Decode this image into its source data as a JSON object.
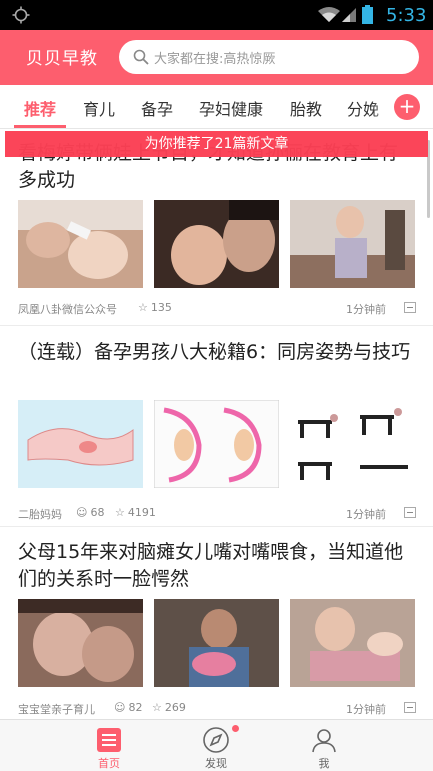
{
  "status_bar": {
    "time": "5:33",
    "icons": [
      "gps-icon",
      "wifi-icon",
      "signal-icon",
      "battery-icon"
    ]
  },
  "header": {
    "app_title": "贝贝早教",
    "search_placeholder": "大家都在搜:高热惊厥",
    "accent_color": "#fd5e6e"
  },
  "tabs": [
    {
      "label": "推荐",
      "active": true
    },
    {
      "label": "育儿",
      "active": false
    },
    {
      "label": "备孕",
      "active": false
    },
    {
      "label": "孕妇健康",
      "active": false
    },
    {
      "label": "胎教",
      "active": false
    },
    {
      "label": "分娩",
      "active": false
    }
  ],
  "add_tab_label": "+",
  "toast": "为你推荐了21篇新文章",
  "articles": [
    {
      "title": "看梅婷带俩娃上节目，才知道孙俪在教育上有多成功",
      "source": "凤凰八卦微信公众号",
      "likes": "135",
      "time": "1分钟前"
    },
    {
      "title": "（连载）备孕男孩八大秘籍6：同房姿势与技巧",
      "source": "二胎妈妈",
      "comments": "68",
      "likes": "4191",
      "time": "1分钟前"
    },
    {
      "title": "父母15年来对脑瘫女儿嘴对嘴喂食，当知道他们的关系时一脸愕然",
      "source": "宝宝堂亲子育儿",
      "comments": "82",
      "likes": "269",
      "time": "1分钟前"
    }
  ],
  "bottom_nav": [
    {
      "label": "首页",
      "icon": "home-list-icon",
      "active": true
    },
    {
      "label": "发现",
      "icon": "compass-icon",
      "active": false,
      "badge": true
    },
    {
      "label": "我",
      "icon": "user-icon",
      "active": false
    }
  ]
}
